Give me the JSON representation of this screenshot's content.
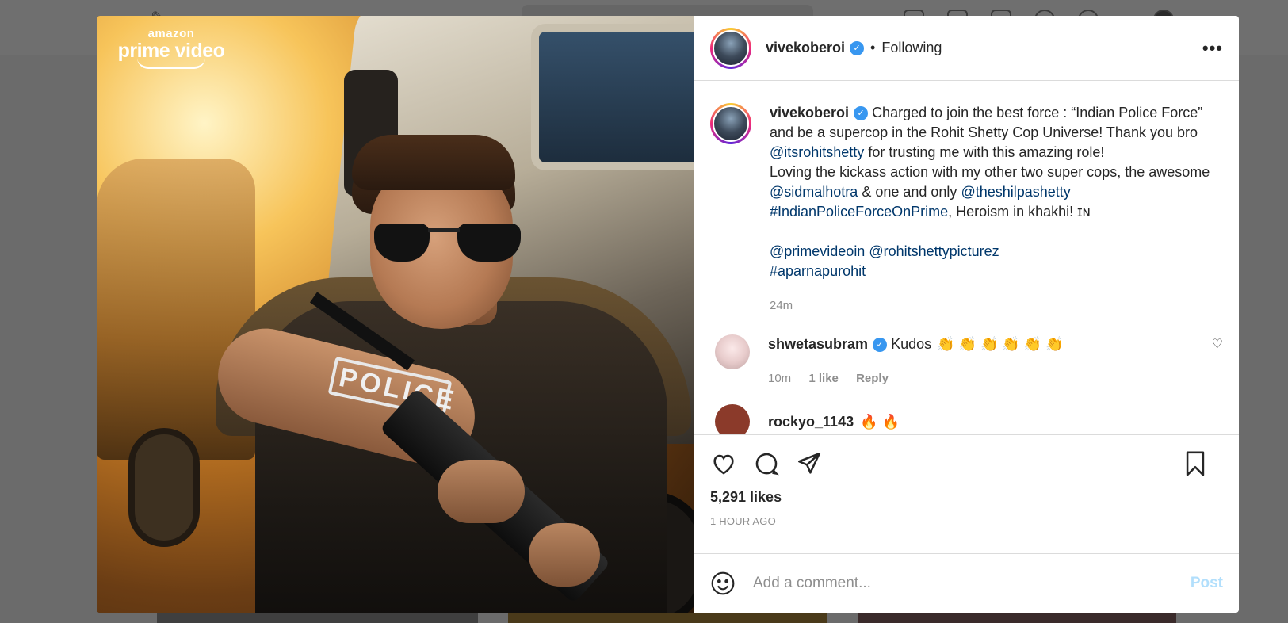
{
  "poster": {
    "brand_small": "amazon",
    "brand_big": "prime video",
    "patch_text": "POLICE"
  },
  "header": {
    "username": "vivekoberoi",
    "follow_status": "Following"
  },
  "caption": {
    "username": "vivekoberoi",
    "text_1": "Charged to join the best force : “Indian Police Force” and be a supercop in the Rohit Shetty Cop Universe! Thank you bro ",
    "mention_1": "@itsrohitshetty",
    "text_2": " for trusting me with this amazing role!",
    "text_3": "Loving the kickass action with my other two super cops, the awesome ",
    "mention_2": "@sidmalhotra",
    "text_4": " & one and only ",
    "mention_3": "@theshilpashetty",
    "hashtag_1": "#IndianPoliceForceOnPrime",
    "text_5": ", Heroism in khakhi! ɪɴ",
    "mention_4": "@primevideoin",
    "mention_5": "@rohitshettypicturez",
    "hashtag_2": "#aparnapurohit",
    "time": "24m"
  },
  "comments": [
    {
      "username": "shwetasubram",
      "text": "Kudos",
      "emoji": "👏 👏 👏 👏 👏 👏",
      "time": "10m",
      "likes": "1 like",
      "reply": "Reply"
    }
  ],
  "peek_comment": {
    "username": "rockyo_1143",
    "emoji": "🔥 🔥"
  },
  "actions": {
    "likes": "5,291 likes",
    "time_ago": "1 HOUR AGO"
  },
  "add_comment": {
    "placeholder": "Add a comment...",
    "post_label": "Post"
  }
}
